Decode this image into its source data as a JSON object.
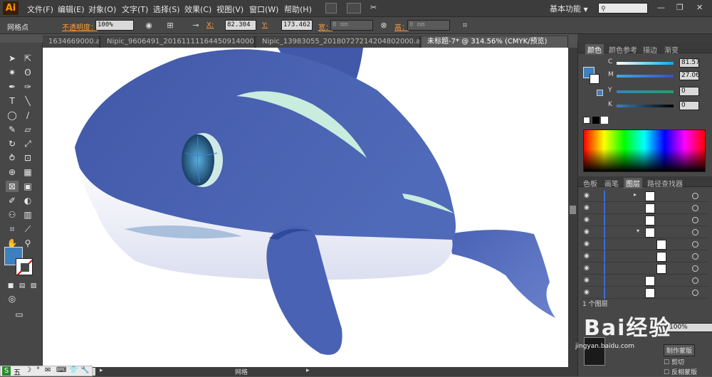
{
  "app": {
    "logo": "Ai",
    "menus": [
      "文件(F)",
      "编辑(E)",
      "对象(O)",
      "文字(T)",
      "选择(S)",
      "效果(C)",
      "视图(V)",
      "窗口(W)",
      "帮助(H)"
    ],
    "workspace": "基本功能",
    "workspace_arrow": "▼"
  },
  "control_bar": {
    "selection_label": "网格点",
    "opacity_label": "不透明度：",
    "opacity_value": "100%",
    "x_label": "X:",
    "x_value": "82.304",
    "y_label": "Y:",
    "y_value": "173.462",
    "width_label": "宽：",
    "width_value": "0 mm",
    "height_label": "高：",
    "height_value": "0 mm"
  },
  "document_tabs": [
    {
      "label": "1634669000.ai*",
      "active": false
    },
    {
      "label": "Nipic_9606491_20161111164450914000.ai*",
      "active": false
    },
    {
      "label": "Nipic_13983055_20180727214204802000.ai*",
      "active": false
    },
    {
      "label": "未标题-7* @ 314.56% (CMYK/预览)",
      "active": true
    }
  ],
  "color_panel": {
    "tabs": [
      "颜色",
      "颜色参考",
      "描边",
      "渐变"
    ],
    "fill_color": "#3d7fbf",
    "channels": [
      {
        "letter": "C",
        "value": "81.57"
      },
      {
        "letter": "M",
        "value": "27.06"
      },
      {
        "letter": "Y",
        "value": "0"
      },
      {
        "letter": "K",
        "value": "0"
      }
    ]
  },
  "layers_panel": {
    "tabs": [
      "色板",
      "画笔",
      "图层",
      "路径查找器"
    ],
    "count_label": "1 个图层"
  },
  "transparency_panel": {
    "percent": "100%",
    "make_mask": "制作蒙版",
    "clip": "剪切",
    "invert_mask": "反相蒙版"
  },
  "status_bar": {
    "zoom_suffix": "6",
    "page": "1",
    "mode": "网格"
  },
  "watermark": "Bai经验",
  "watermark_sub": "jingyan.baidu.com",
  "taskbar": [
    "五",
    "☽",
    "°",
    "✉",
    "⌨",
    "👕",
    "🔧"
  ],
  "colors": {
    "whale_body": "#4a64b0",
    "whale_belly": "#ffffff",
    "eye_white": "#cfe9e6",
    "accent_stripe": "#bfe8dc"
  }
}
